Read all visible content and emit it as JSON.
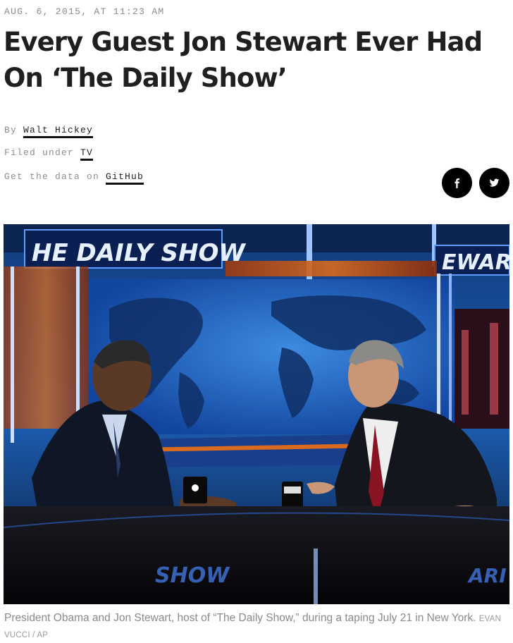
{
  "article": {
    "dateline": "AUG. 6, 2015, AT 11:23 AM",
    "headline": "Every Guest Jon Stewart Ever Had On ‘The Daily Show’",
    "byline_prefix": "By",
    "author": "Walt Hickey",
    "filed_prefix": "Filed under",
    "filed_topic": "TV",
    "data_prefix": "Get the data on",
    "data_link": "GitHub"
  },
  "share": {
    "facebook_icon": "facebook-icon",
    "twitter_icon": "twitter-icon",
    "button_color": "#000000"
  },
  "photo": {
    "sign_left": "HE DAILY SHOW",
    "sign_right": "EWAR",
    "desk_text": "SHOW",
    "desk_text_right": "ARI"
  },
  "caption": {
    "text": "President Obama and Jon Stewart, host of “The Daily Show,” during a taping July 21 in New York.",
    "credit": "EVAN VUCCI / AP"
  }
}
